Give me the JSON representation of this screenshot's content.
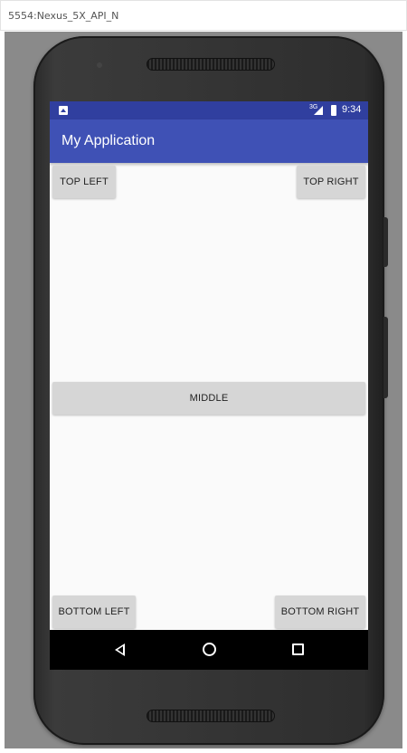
{
  "window": {
    "title": "5554:Nexus_5X_API_N"
  },
  "status_bar": {
    "network": "3G",
    "time": "9:34",
    "notification_icon": "android-notification-icon",
    "signal_icon": "signal-icon",
    "battery_icon": "battery-icon"
  },
  "app_bar": {
    "title": "My Application"
  },
  "buttons": {
    "top_left": "TOP LEFT",
    "top_right": "TOP RIGHT",
    "middle": "MIDDLE",
    "bottom_left": "BOTTOM LEFT",
    "bottom_right": "BOTTOM RIGHT"
  },
  "nav_bar": {
    "back_icon": "back-triangle-icon",
    "home_icon": "home-circle-icon",
    "recents_icon": "recents-square-icon"
  },
  "colors": {
    "status_bar": "#303f9f",
    "app_bar": "#3f51b5",
    "screen_background": "#fafafa",
    "button": "#d6d6d6",
    "nav_bar": "#000000",
    "emulator_background": "#8a8a8a"
  }
}
